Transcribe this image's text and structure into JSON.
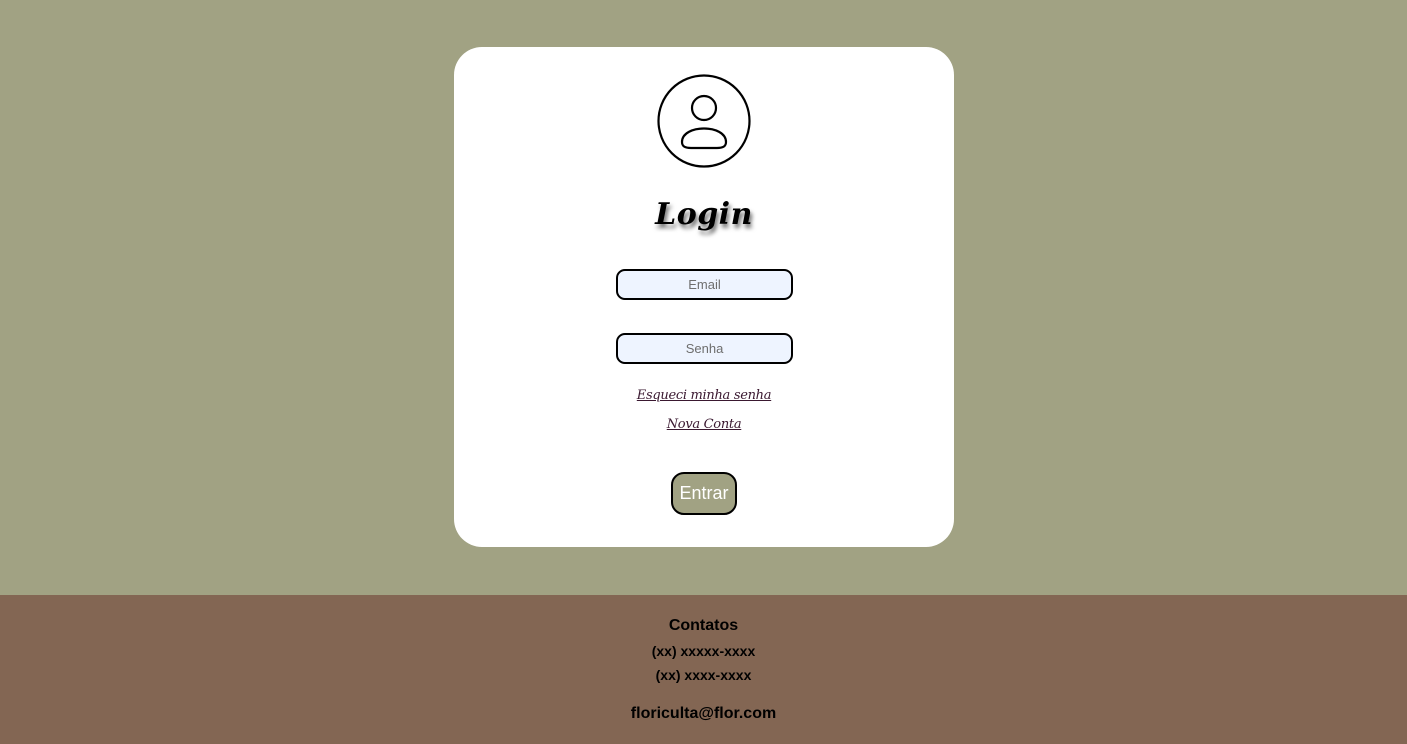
{
  "login": {
    "title": "Login",
    "email_placeholder": "Email",
    "password_placeholder": "Senha",
    "forgot_link": "Esqueci minha senha",
    "new_account_link": "Nova Conta",
    "submit_label": "Entrar",
    "avatar_icon": "user-circle-icon"
  },
  "footer": {
    "title": "Contatos",
    "phone1": "(xx) xxxxx-xxxx",
    "phone2": "(xx) xxxx-xxxx",
    "email": "floricultа@flor.com"
  },
  "colors": {
    "background": "#a1a283",
    "card": "#ffffff",
    "footer": "#836653",
    "input_bg": "#eef4ff",
    "button_bg": "#a1a283",
    "link": "#3a1830"
  }
}
